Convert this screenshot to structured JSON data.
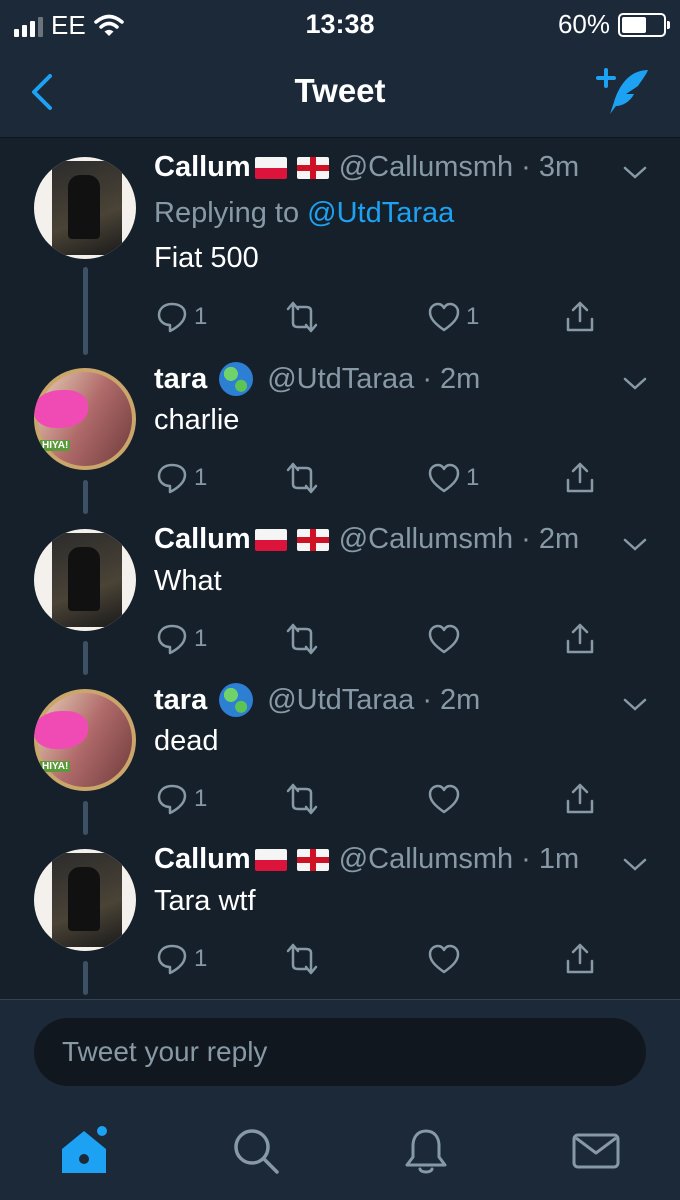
{
  "status_bar": {
    "carrier": "EE",
    "time": "13:38",
    "battery": "60%",
    "battery_level": 0.6
  },
  "nav": {
    "title": "Tweet",
    "back_icon": "chevron-left-icon",
    "compose_icon": "compose-tweet-icon"
  },
  "tweets": [
    {
      "name": "Callum",
      "handle": "@Callumsmh",
      "time": "· 3m",
      "replying_label": "Replying to",
      "replying_to": "@UtdTaraa",
      "text": "Fiat 500",
      "reply_count": "1",
      "like_count": "1"
    },
    {
      "name": "tara",
      "handle": "@UtdTaraa",
      "time": "· 2m",
      "text": "charlie",
      "reply_count": "1",
      "like_count": "1"
    },
    {
      "name": "Callum",
      "handle": "@Callumsmh",
      "time": "· 2m",
      "text": "What",
      "reply_count": "1",
      "like_count": ""
    },
    {
      "name": "tara",
      "handle": "@UtdTaraa",
      "time": "· 2m",
      "text": "dead",
      "reply_count": "1",
      "like_count": ""
    },
    {
      "name": "Callum",
      "handle": "@Callumsmh",
      "time": "· 1m",
      "text": "Tara wtf",
      "reply_count": "1",
      "like_count": ""
    }
  ],
  "reply_box": {
    "placeholder": "Tweet your reply"
  },
  "tab_bar": {
    "items": [
      "home-icon",
      "search-icon",
      "notifications-icon",
      "messages-icon"
    ]
  },
  "colors": {
    "background": "#15202b",
    "bar": "#1c2938",
    "accent": "#1da1f2",
    "secondary_text": "#8899a6"
  }
}
